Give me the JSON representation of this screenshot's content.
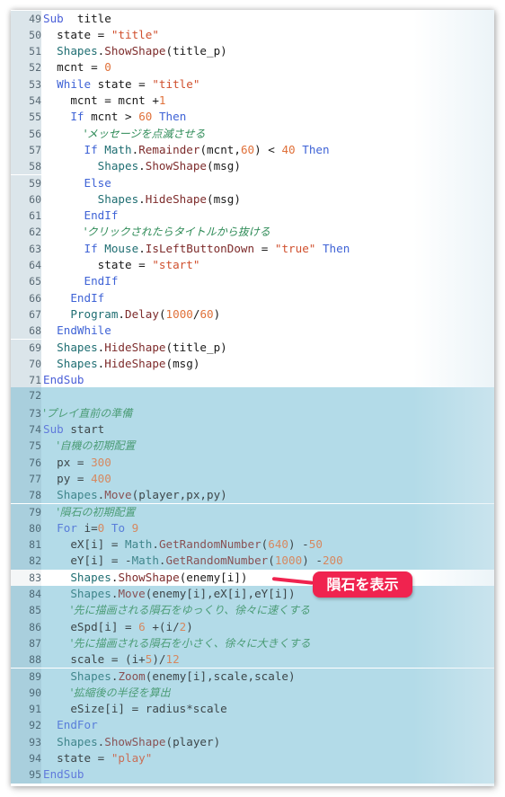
{
  "editor": {
    "first_line": 49,
    "highlight_range": [
      72,
      95
    ],
    "selected_line": 83,
    "lines": [
      {
        "n": "49",
        "tokens": [
          [
            "kw",
            "Sub"
          ],
          [
            "",
            "  title"
          ]
        ]
      },
      {
        "n": "50",
        "tokens": [
          [
            "",
            "  state = "
          ],
          [
            "str",
            "\"title\""
          ]
        ]
      },
      {
        "n": "51",
        "tokens": [
          [
            "",
            "  "
          ],
          [
            "obj",
            "Shapes"
          ],
          [
            "",
            "."
          ],
          [
            "meth",
            "ShowShape"
          ],
          [
            "",
            "(title_p)"
          ]
        ]
      },
      {
        "n": "52",
        "tokens": [
          [
            "",
            "  mcnt = "
          ],
          [
            "num",
            "0"
          ]
        ]
      },
      {
        "n": "53",
        "tokens": [
          [
            "",
            "  "
          ],
          [
            "kw2",
            "While"
          ],
          [
            "",
            " state = "
          ],
          [
            "str",
            "\"title\""
          ]
        ]
      },
      {
        "n": "54",
        "tokens": [
          [
            "",
            "    mcnt = mcnt +"
          ],
          [
            "num",
            "1"
          ]
        ]
      },
      {
        "n": "55",
        "tokens": [
          [
            "",
            "    "
          ],
          [
            "kw2",
            "If"
          ],
          [
            "",
            " mcnt > "
          ],
          [
            "num",
            "60"
          ],
          [
            "",
            " "
          ],
          [
            "kw2",
            "Then"
          ]
        ]
      },
      {
        "n": "56",
        "tokens": [
          [
            "",
            "      "
          ],
          [
            "cmt",
            "'メッセージを点滅させる"
          ]
        ]
      },
      {
        "n": "57",
        "tokens": [
          [
            "",
            "      "
          ],
          [
            "kw2",
            "If"
          ],
          [
            "",
            " "
          ],
          [
            "obj",
            "Math"
          ],
          [
            "",
            "."
          ],
          [
            "meth",
            "Remainder"
          ],
          [
            "",
            "(mcnt,"
          ],
          [
            "num",
            "60"
          ],
          [
            "",
            ") < "
          ],
          [
            "num",
            "40"
          ],
          [
            "",
            " "
          ],
          [
            "kw2",
            "Then"
          ]
        ]
      },
      {
        "n": "58",
        "tokens": [
          [
            "",
            "        "
          ],
          [
            "obj",
            "Shapes"
          ],
          [
            "",
            "."
          ],
          [
            "meth",
            "ShowShape"
          ],
          [
            "",
            "(msg)"
          ]
        ]
      },
      {
        "n": "59",
        "tokens": [
          [
            "",
            "      "
          ],
          [
            "kw2",
            "Else"
          ]
        ]
      },
      {
        "n": "60",
        "tokens": [
          [
            "",
            "        "
          ],
          [
            "obj",
            "Shapes"
          ],
          [
            "",
            "."
          ],
          [
            "meth",
            "HideShape"
          ],
          [
            "",
            "(msg)"
          ]
        ]
      },
      {
        "n": "61",
        "tokens": [
          [
            "",
            "      "
          ],
          [
            "kw2",
            "EndIf"
          ]
        ]
      },
      {
        "n": "62",
        "tokens": [
          [
            "",
            "      "
          ],
          [
            "cmt",
            "'クリックされたらタイトルから抜ける"
          ]
        ]
      },
      {
        "n": "63",
        "tokens": [
          [
            "",
            "      "
          ],
          [
            "kw2",
            "If"
          ],
          [
            "",
            " "
          ],
          [
            "obj",
            "Mouse"
          ],
          [
            "",
            "."
          ],
          [
            "meth",
            "IsLeftButtonDown"
          ],
          [
            "",
            " = "
          ],
          [
            "str",
            "\"true\""
          ],
          [
            "",
            " "
          ],
          [
            "kw2",
            "Then"
          ]
        ]
      },
      {
        "n": "64",
        "tokens": [
          [
            "",
            "        state = "
          ],
          [
            "str",
            "\"start\""
          ]
        ]
      },
      {
        "n": "65",
        "tokens": [
          [
            "",
            "      "
          ],
          [
            "kw2",
            "EndIf"
          ]
        ]
      },
      {
        "n": "66",
        "tokens": [
          [
            "",
            "    "
          ],
          [
            "kw2",
            "EndIf"
          ]
        ]
      },
      {
        "n": "67",
        "tokens": [
          [
            "",
            "    "
          ],
          [
            "obj",
            "Program"
          ],
          [
            "",
            "."
          ],
          [
            "meth",
            "Delay"
          ],
          [
            "",
            "("
          ],
          [
            "num",
            "1000"
          ],
          [
            "",
            "/"
          ],
          [
            "num",
            "60"
          ],
          [
            "",
            ")"
          ]
        ]
      },
      {
        "n": "68",
        "tokens": [
          [
            "",
            "  "
          ],
          [
            "kw2",
            "EndWhile"
          ]
        ]
      },
      {
        "n": "69",
        "tokens": [
          [
            "",
            "  "
          ],
          [
            "obj",
            "Shapes"
          ],
          [
            "",
            "."
          ],
          [
            "meth",
            "HideShape"
          ],
          [
            "",
            "(title_p)"
          ]
        ]
      },
      {
        "n": "70",
        "tokens": [
          [
            "",
            "  "
          ],
          [
            "obj",
            "Shapes"
          ],
          [
            "",
            "."
          ],
          [
            "meth",
            "HideShape"
          ],
          [
            "",
            "(msg)"
          ]
        ]
      },
      {
        "n": "71",
        "tokens": [
          [
            "kw",
            "EndSub"
          ]
        ]
      },
      {
        "n": "72",
        "tokens": []
      },
      {
        "n": "73",
        "tokens": [
          [
            "cmt",
            "'プレイ直前の準備"
          ]
        ]
      },
      {
        "n": "74",
        "tokens": [
          [
            "kw",
            "Sub"
          ],
          [
            "",
            " start"
          ]
        ]
      },
      {
        "n": "75",
        "tokens": [
          [
            "",
            "  "
          ],
          [
            "cmt",
            "'自機の初期配置"
          ]
        ]
      },
      {
        "n": "76",
        "tokens": [
          [
            "",
            "  px = "
          ],
          [
            "num",
            "300"
          ]
        ]
      },
      {
        "n": "77",
        "tokens": [
          [
            "",
            "  py = "
          ],
          [
            "num",
            "400"
          ]
        ]
      },
      {
        "n": "78",
        "tokens": [
          [
            "",
            "  "
          ],
          [
            "obj",
            "Shapes"
          ],
          [
            "",
            "."
          ],
          [
            "meth",
            "Move"
          ],
          [
            "",
            "(player,px,py)"
          ]
        ]
      },
      {
        "n": "79",
        "tokens": [
          [
            "",
            "  "
          ],
          [
            "cmt",
            "'隕石の初期配置"
          ]
        ]
      },
      {
        "n": "80",
        "tokens": [
          [
            "",
            "  "
          ],
          [
            "kw2",
            "For"
          ],
          [
            "",
            " i="
          ],
          [
            "num",
            "0"
          ],
          [
            "",
            " "
          ],
          [
            "kw2",
            "To"
          ],
          [
            "",
            " "
          ],
          [
            "num",
            "9"
          ]
        ]
      },
      {
        "n": "81",
        "tokens": [
          [
            "",
            "    eX[i] = "
          ],
          [
            "obj",
            "Math"
          ],
          [
            "",
            "."
          ],
          [
            "meth",
            "GetRandomNumber"
          ],
          [
            "",
            "("
          ],
          [
            "num",
            "640"
          ],
          [
            "",
            ") -"
          ],
          [
            "num",
            "50"
          ]
        ]
      },
      {
        "n": "82",
        "tokens": [
          [
            "",
            "    eY[i] = -"
          ],
          [
            "obj",
            "Math"
          ],
          [
            "",
            "."
          ],
          [
            "meth",
            "GetRandomNumber"
          ],
          [
            "",
            "("
          ],
          [
            "num",
            "1000"
          ],
          [
            "",
            ") -"
          ],
          [
            "num",
            "200"
          ]
        ]
      },
      {
        "n": "83",
        "tokens": [
          [
            "",
            "    "
          ],
          [
            "obj",
            "Shapes"
          ],
          [
            "",
            "."
          ],
          [
            "meth",
            "ShowShape"
          ],
          [
            "",
            "(enemy[i])"
          ]
        ]
      },
      {
        "n": "84",
        "tokens": [
          [
            "",
            "    "
          ],
          [
            "obj",
            "Shapes"
          ],
          [
            "",
            "."
          ],
          [
            "meth",
            "Move"
          ],
          [
            "",
            "(enemy[i],eX[i],eY[i])"
          ]
        ]
      },
      {
        "n": "85",
        "tokens": [
          [
            "",
            "    "
          ],
          [
            "cmt",
            "'先に描画される隕石をゆっくり、徐々に速くする"
          ]
        ]
      },
      {
        "n": "86",
        "tokens": [
          [
            "",
            "    eSpd[i] = "
          ],
          [
            "num",
            "6"
          ],
          [
            "",
            " +(i/"
          ],
          [
            "num",
            "2"
          ],
          [
            "",
            ")"
          ]
        ]
      },
      {
        "n": "87",
        "tokens": [
          [
            "",
            "    "
          ],
          [
            "cmt",
            "'先に描画される隕石を小さく、徐々に大きくする"
          ]
        ]
      },
      {
        "n": "88",
        "tokens": [
          [
            "",
            "    scale = (i+"
          ],
          [
            "num",
            "5"
          ],
          [
            "",
            ")/"
          ],
          [
            "num",
            "12"
          ]
        ]
      },
      {
        "n": "89",
        "tokens": [
          [
            "",
            "    "
          ],
          [
            "obj",
            "Shapes"
          ],
          [
            "",
            "."
          ],
          [
            "meth",
            "Zoom"
          ],
          [
            "",
            "(enemy[i],scale,scale)"
          ]
        ]
      },
      {
        "n": "90",
        "tokens": [
          [
            "",
            "    "
          ],
          [
            "cmt",
            "'拡縮後の半径を算出"
          ]
        ]
      },
      {
        "n": "91",
        "tokens": [
          [
            "",
            "    eSize[i] = radius*scale"
          ]
        ]
      },
      {
        "n": "92",
        "tokens": [
          [
            "",
            "  "
          ],
          [
            "kw2",
            "EndFor"
          ]
        ]
      },
      {
        "n": "93",
        "tokens": [
          [
            "",
            "  "
          ],
          [
            "obj",
            "Shapes"
          ],
          [
            "",
            "."
          ],
          [
            "meth",
            "ShowShape"
          ],
          [
            "",
            "(player)"
          ]
        ]
      },
      {
        "n": "94",
        "tokens": [
          [
            "",
            "  state = "
          ],
          [
            "str",
            "\"play\""
          ]
        ]
      },
      {
        "n": "95",
        "tokens": [
          [
            "kw",
            "EndSub"
          ]
        ]
      }
    ]
  },
  "callout": {
    "label": "隕石を表示",
    "color": "#f0234f"
  },
  "colors": {
    "highlight": "#b3dbe8",
    "gutter": "#dbe5ea"
  }
}
